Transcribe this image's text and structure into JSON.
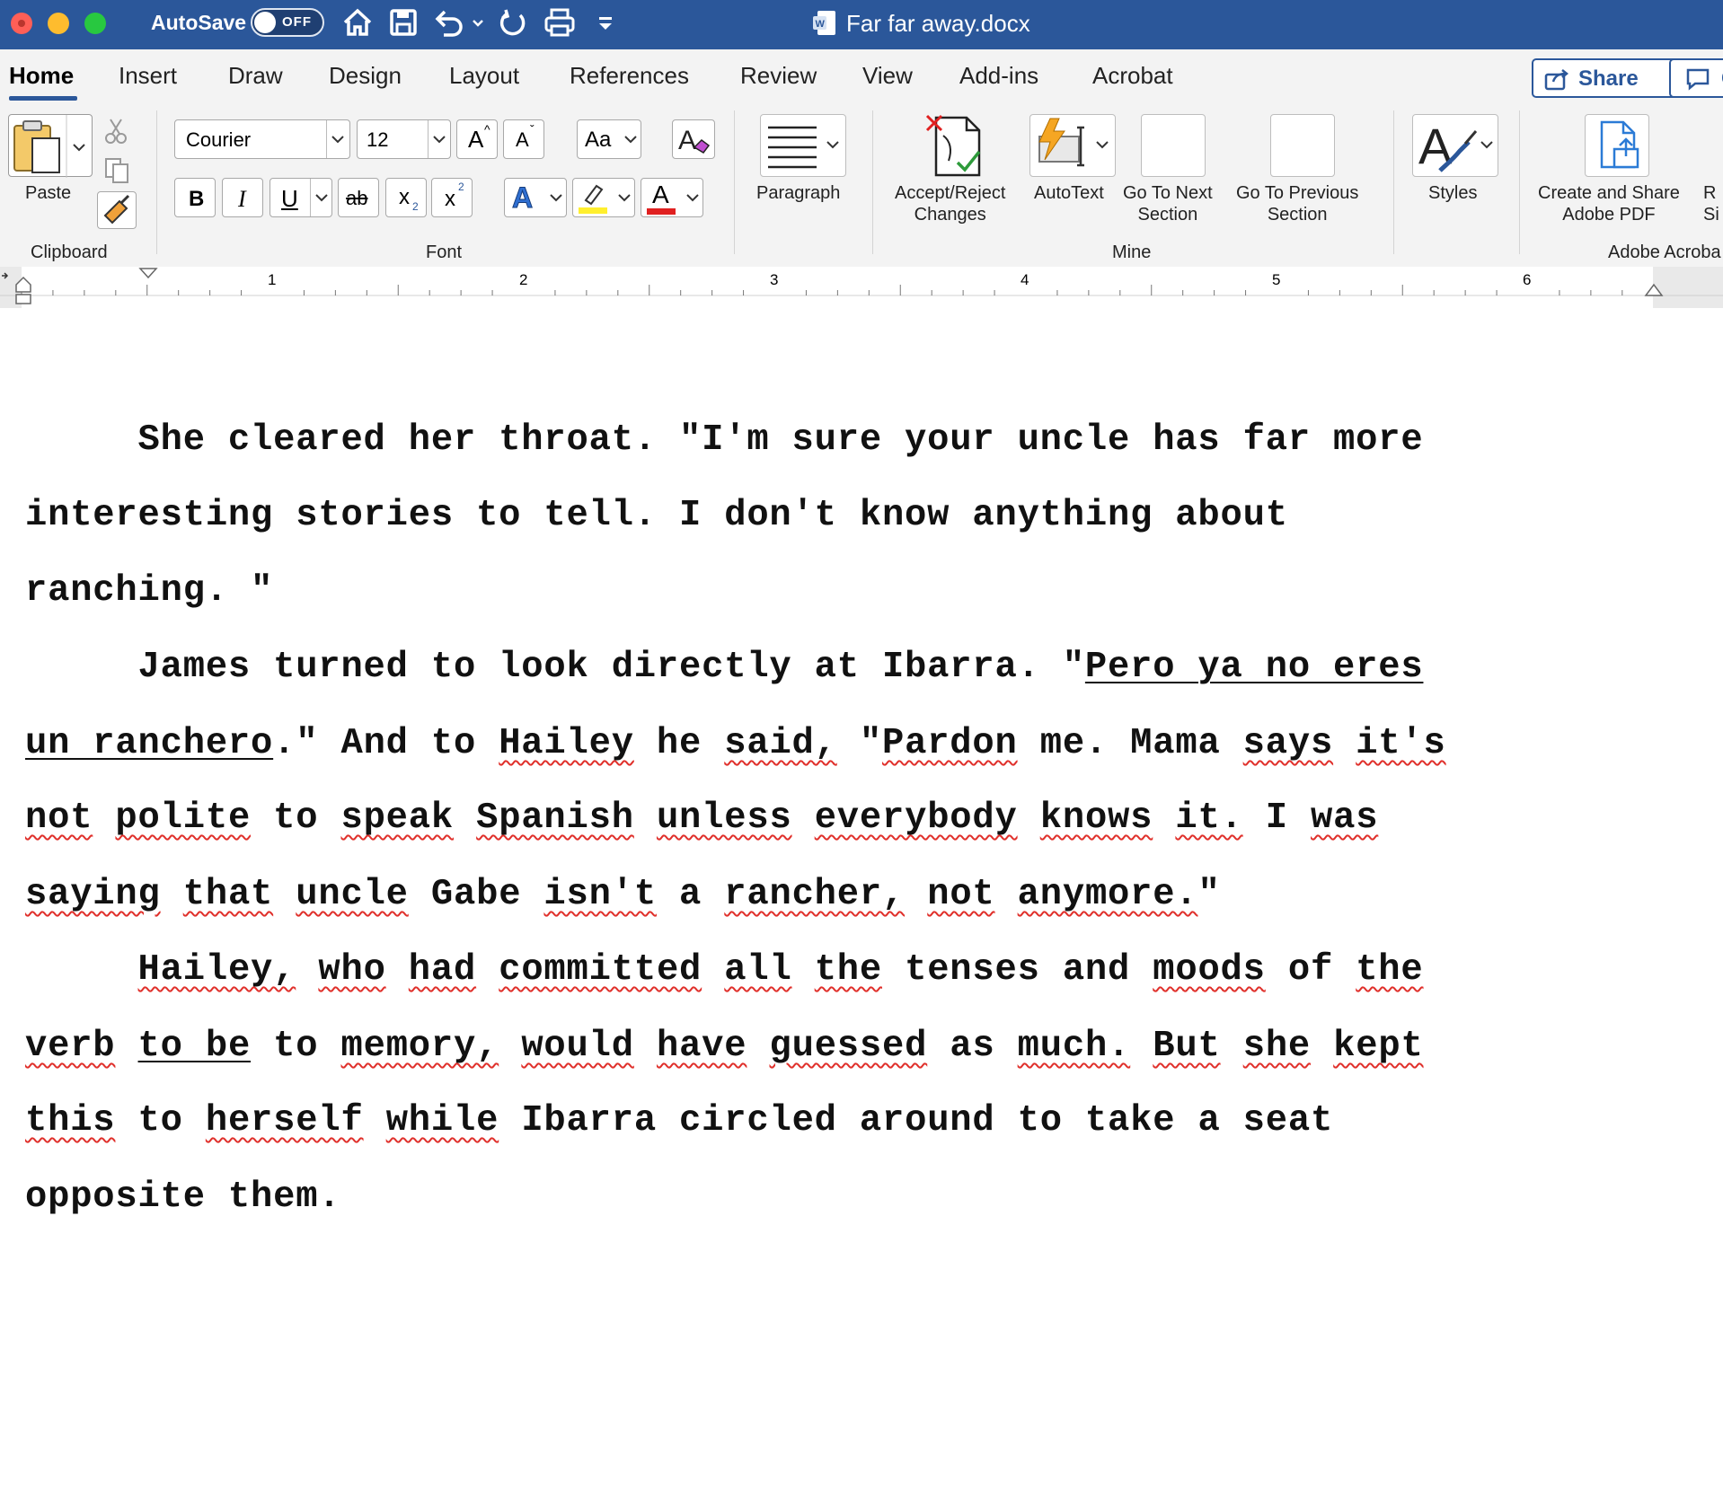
{
  "titlebar": {
    "autosave_label": "AutoSave",
    "autosave_state": "OFF",
    "document_title": "Far far away.docx",
    "colors": {
      "bar": "#2b579a"
    }
  },
  "tabs": [
    "Home",
    "Insert",
    "Draw",
    "Design",
    "Layout",
    "References",
    "Review",
    "View",
    "Add-ins",
    "Acrobat"
  ],
  "active_tab": "Home",
  "toolbar": {
    "share_label": "Share",
    "comments_label": "C"
  },
  "clipboard": {
    "paste_label": "Paste",
    "group_label": "Clipboard"
  },
  "font": {
    "name": "Courier",
    "size": "12",
    "group_label": "Font",
    "case_label": "Aa",
    "bold": "B",
    "italic": "I",
    "underline": "U",
    "strike": "ab",
    "sub": "x",
    "sup": "x",
    "grow": "A",
    "shrink": "A",
    "text_effects": "A",
    "font_color": "A"
  },
  "paragraph": {
    "label": "Paragraph"
  },
  "mine": {
    "group_label": "Mine",
    "accept_reject": [
      "Accept/Reject",
      "Changes"
    ],
    "autotext": "AutoText",
    "next_section": [
      "Go To Next",
      "Section"
    ],
    "prev_section": [
      "Go To Previous",
      "Section"
    ]
  },
  "styles": {
    "label": "Styles"
  },
  "acrobat": {
    "create_share": [
      "Create and Share",
      "Adobe PDF"
    ],
    "group_label": "Adobe Acroba",
    "partial_next": [
      "R",
      "Si"
    ]
  },
  "ruler": {
    "numbers": [
      "1",
      "2",
      "3",
      "4",
      "5",
      "6"
    ]
  },
  "document": {
    "lines": [
      [
        {
          "t": "     She cleared her throat. \"I'm sure your uncle has far more"
        }
      ],
      [
        {
          "t": "interesting stories to tell. I don't know anything about"
        }
      ],
      [
        {
          "t": "ranching. \""
        }
      ],
      [
        {
          "t": "     James turned to look directly at Ibarra. \""
        },
        {
          "t": "Pero ya no eres",
          "s": "u"
        }
      ],
      [
        {
          "t": "un ranchero",
          "s": "u"
        },
        {
          "t": ".\" And to "
        },
        {
          "t": "Hailey",
          "s": "sp"
        },
        {
          "t": " he "
        },
        {
          "t": "said,",
          "s": "sp"
        },
        {
          "t": " \""
        },
        {
          "t": "Pardon",
          "s": "sp"
        },
        {
          "t": " me. Mama "
        },
        {
          "t": "says",
          "s": "sp"
        },
        {
          "t": " "
        },
        {
          "t": "it's",
          "s": "sp"
        }
      ],
      [
        {
          "t": "not",
          "s": "sp"
        },
        {
          "t": " "
        },
        {
          "t": "polite",
          "s": "sp"
        },
        {
          "t": " to "
        },
        {
          "t": "speak",
          "s": "sp"
        },
        {
          "t": " "
        },
        {
          "t": "Spanish",
          "s": "sp"
        },
        {
          "t": " "
        },
        {
          "t": "unless",
          "s": "sp"
        },
        {
          "t": " "
        },
        {
          "t": "everybody",
          "s": "sp"
        },
        {
          "t": " "
        },
        {
          "t": "knows",
          "s": "sp"
        },
        {
          "t": " "
        },
        {
          "t": "it.",
          "s": "sp"
        },
        {
          "t": " I "
        },
        {
          "t": "was",
          "s": "sp"
        }
      ],
      [
        {
          "t": "saying",
          "s": "sp"
        },
        {
          "t": " "
        },
        {
          "t": "that",
          "s": "sp"
        },
        {
          "t": " "
        },
        {
          "t": "uncle",
          "s": "sp"
        },
        {
          "t": " Gabe "
        },
        {
          "t": "isn't",
          "s": "sp"
        },
        {
          "t": " a "
        },
        {
          "t": "rancher,",
          "s": "sp"
        },
        {
          "t": " "
        },
        {
          "t": "not",
          "s": "sp"
        },
        {
          "t": " "
        },
        {
          "t": "anymore.",
          "s": "sp"
        },
        {
          "t": "\""
        }
      ],
      [
        {
          "t": "     "
        },
        {
          "t": "Hailey,",
          "s": "sp"
        },
        {
          "t": " "
        },
        {
          "t": "who",
          "s": "sp"
        },
        {
          "t": " "
        },
        {
          "t": "had",
          "s": "sp"
        },
        {
          "t": " "
        },
        {
          "t": "committed",
          "s": "sp"
        },
        {
          "t": " "
        },
        {
          "t": "all",
          "s": "sp"
        },
        {
          "t": " "
        },
        {
          "t": "the",
          "s": "sp"
        },
        {
          "t": " tenses and "
        },
        {
          "t": "moods",
          "s": "sp"
        },
        {
          "t": " of "
        },
        {
          "t": "the",
          "s": "sp"
        }
      ],
      [
        {
          "t": "verb",
          "s": "sp"
        },
        {
          "t": " "
        },
        {
          "t": "to be",
          "s": "u"
        },
        {
          "t": " to "
        },
        {
          "t": "memory,",
          "s": "sp"
        },
        {
          "t": " "
        },
        {
          "t": "would",
          "s": "sp"
        },
        {
          "t": " "
        },
        {
          "t": "have",
          "s": "sp"
        },
        {
          "t": " "
        },
        {
          "t": "guessed",
          "s": "sp"
        },
        {
          "t": " as "
        },
        {
          "t": "much.",
          "s": "sp"
        },
        {
          "t": " "
        },
        {
          "t": "But",
          "s": "sp"
        },
        {
          "t": " "
        },
        {
          "t": "she",
          "s": "sp"
        },
        {
          "t": " "
        },
        {
          "t": "kept",
          "s": "sp"
        }
      ],
      [
        {
          "t": "this",
          "s": "sp"
        },
        {
          "t": " to "
        },
        {
          "t": "herself",
          "s": "sp"
        },
        {
          "t": " "
        },
        {
          "t": "while",
          "s": "sp"
        },
        {
          "t": " Ibarra circled around to take a seat"
        }
      ],
      [
        {
          "t": "opposite them."
        }
      ]
    ]
  }
}
